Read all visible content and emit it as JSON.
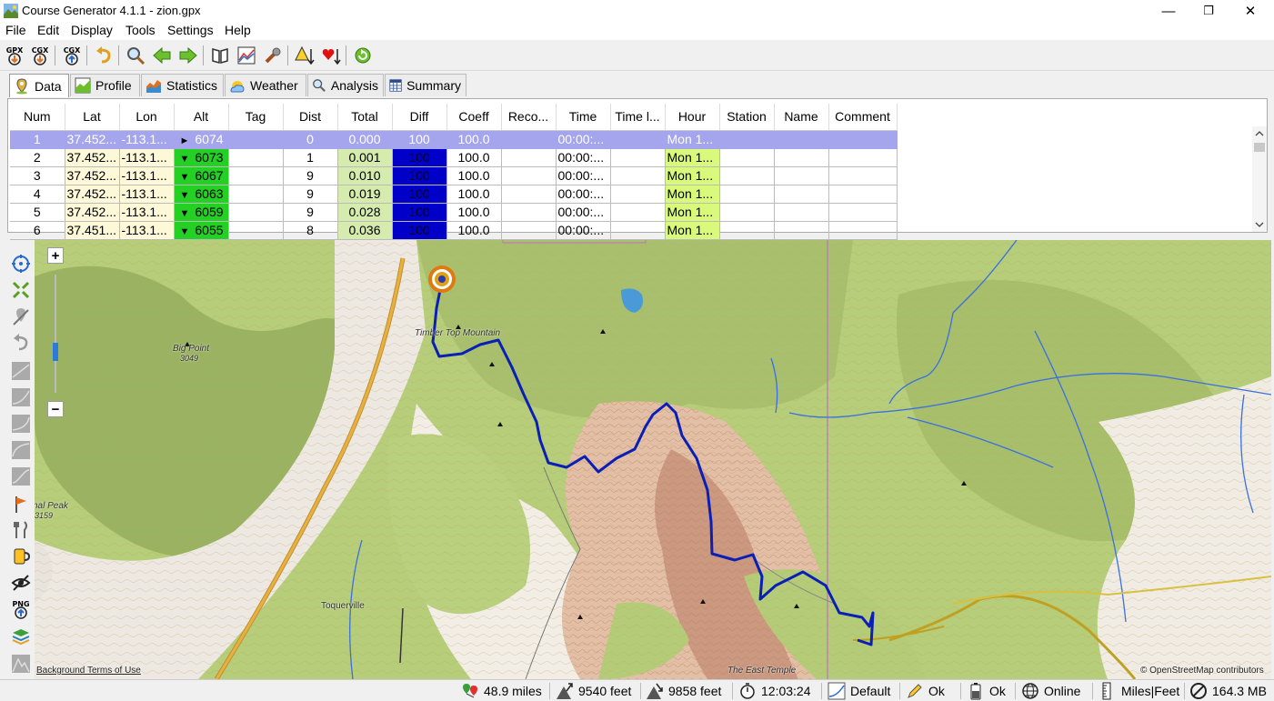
{
  "window": {
    "title": "Course Generator 4.1.1 - zion.gpx",
    "minimize": "—",
    "maximize": "❐",
    "close": "✕"
  },
  "menu": [
    "File",
    "Edit",
    "Display",
    "Tools",
    "Settings",
    "Help"
  ],
  "toolbar": {
    "items": [
      "open-gpx-icon",
      "open-cgx-icon",
      "save-cgx-icon",
      "undo-icon",
      "search-icon",
      "previous-icon",
      "next-icon",
      "book-icon",
      "profile-chart-icon",
      "settings-wrench-icon",
      "warning-next-icon",
      "heart-next-icon",
      "refresh-icon"
    ],
    "gpx_label": "GPX",
    "cgx_label": "CGX"
  },
  "tabs": [
    {
      "label": "Data",
      "icon": "map-pin-icon",
      "active": true
    },
    {
      "label": "Profile",
      "icon": "profile-icon",
      "active": false
    },
    {
      "label": "Statistics",
      "icon": "statistics-icon",
      "active": false
    },
    {
      "label": "Weather",
      "icon": "weather-icon",
      "active": false
    },
    {
      "label": "Analysis",
      "icon": "magnifier-icon",
      "active": false
    },
    {
      "label": "Summary",
      "icon": "summary-table-icon",
      "active": false
    }
  ],
  "table": {
    "columns": [
      "Num",
      "Lat",
      "Lon",
      "Alt",
      "Tag",
      "Dist",
      "Total",
      "Diff",
      "Coeff",
      "Reco...",
      "Time",
      "Time l...",
      "Hour",
      "Station",
      "Name",
      "Comment"
    ],
    "rows": [
      {
        "num": "1",
        "lat": "37.452...",
        "lon": "-113.1...",
        "alt_marker": "►",
        "alt": "6074",
        "tag": "",
        "dist": "0",
        "total": "0.000",
        "diff": "100",
        "coeff": "100.0",
        "reco": "",
        "time": "00:00:...",
        "time_l": "",
        "hour": "Mon 1...",
        "station": "",
        "name": "",
        "comment": ""
      },
      {
        "num": "2",
        "lat": "37.452...",
        "lon": "-113.1...",
        "alt_marker": "▼",
        "alt": "6073",
        "tag": "",
        "dist": "1",
        "total": "0.001",
        "diff": "100",
        "coeff": "100.0",
        "reco": "",
        "time": "00:00:...",
        "time_l": "",
        "hour": "Mon 1...",
        "station": "",
        "name": "",
        "comment": ""
      },
      {
        "num": "3",
        "lat": "37.452...",
        "lon": "-113.1...",
        "alt_marker": "▼",
        "alt": "6067",
        "tag": "",
        "dist": "9",
        "total": "0.010",
        "diff": "100",
        "coeff": "100.0",
        "reco": "",
        "time": "00:00:...",
        "time_l": "",
        "hour": "Mon 1...",
        "station": "",
        "name": "",
        "comment": ""
      },
      {
        "num": "4",
        "lat": "37.452...",
        "lon": "-113.1...",
        "alt_marker": "▼",
        "alt": "6063",
        "tag": "",
        "dist": "9",
        "total": "0.019",
        "diff": "100",
        "coeff": "100.0",
        "reco": "",
        "time": "00:00:...",
        "time_l": "",
        "hour": "Mon 1...",
        "station": "",
        "name": "",
        "comment": ""
      },
      {
        "num": "5",
        "lat": "37.452...",
        "lon": "-113.1...",
        "alt_marker": "▼",
        "alt": "6059",
        "tag": "",
        "dist": "9",
        "total": "0.028",
        "diff": "100",
        "coeff": "100.0",
        "reco": "",
        "time": "00:00:...",
        "time_l": "",
        "hour": "Mon 1...",
        "station": "",
        "name": "",
        "comment": ""
      },
      {
        "num": "6",
        "lat": "37.451...",
        "lon": "-113.1...",
        "alt_marker": "▼",
        "alt": "6055",
        "tag": "",
        "dist": "8",
        "total": "0.036",
        "diff": "100",
        "coeff": "100.0",
        "reco": "",
        "time": "00:00:...",
        "time_l": "",
        "hour": "Mon 1...",
        "station": "",
        "name": "",
        "comment": ""
      }
    ]
  },
  "map": {
    "zoom_in": "+",
    "zoom_out": "−",
    "zoom_level_fraction": 0.35,
    "labels": {
      "big_point_name": "Big Point",
      "big_point_elev": "3049",
      "timber_top": "Timber Top Mountain",
      "signal_peak_name": "nal Peak",
      "signal_peak_elev": "3159",
      "toquerville": "Toquerville",
      "east_temple": "The East Temple",
      "background_terms": "Background Terms of Use",
      "osm_credit": "© OpenStreetMap contributors"
    },
    "colors": {
      "track": "#0a1fb5",
      "water": "#3a6fe0",
      "road": "#d9c040",
      "start_marker": "#e07a10"
    }
  },
  "map_tools": [
    "center-track-icon",
    "fit-track-icon",
    "hide-marker-icon",
    "undo-map-icon",
    "curve-1-icon",
    "curve-2-icon",
    "curve-3-icon",
    "curve-4-icon",
    "curve-5-icon",
    "flag-icon",
    "fork-knife-icon",
    "drink-icon",
    "eye-crossed-icon",
    "png-export-icon",
    "layers-icon",
    "mountain-profile-icon"
  ],
  "png_label": "PNG",
  "status": {
    "distance": "48.9 miles",
    "climb": "9540 feet",
    "descent": "9858 feet",
    "time": "12:03:24",
    "curve": "Default",
    "check": "Ok",
    "battery": "Ok",
    "online": "Online",
    "units": "Miles|Feet",
    "memory": "164.3 MB"
  }
}
